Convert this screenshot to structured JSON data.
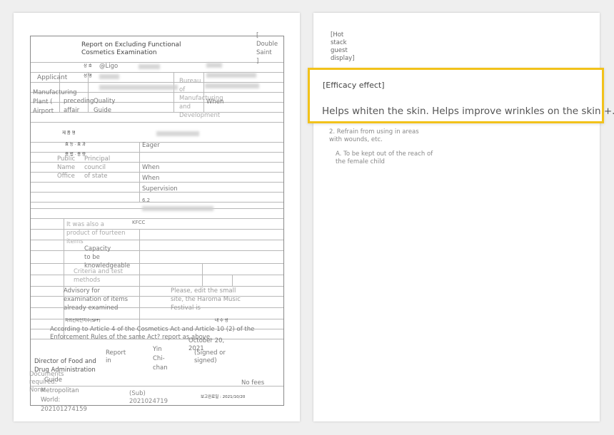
{
  "left_page": {
    "title_line1": "Report on Excluding Functional",
    "title_line2": "Cosmetics Examination",
    "double_saint": [
      "[",
      "Double",
      "Saint",
      "]"
    ],
    "applicant_label": "Applicant",
    "applicant_value": "@Ligo",
    "bureau": [
      "Bureau",
      "of",
      "Manufacturing",
      "and",
      "Development"
    ],
    "when": "When",
    "manufacturing_plant": [
      "Manufacturing",
      "Plant (",
      "Airport"
    ],
    "preceding": [
      "preceding",
      "affair"
    ],
    "quality_guide": [
      "Quality",
      "Guide"
    ],
    "korean_header": [
      "상  호",
      "성  명",
      "제   품   명",
      "효  능 · 효  과",
      "용   법 · 용   량"
    ],
    "eager": "Eager",
    "public_name_office": [
      "Public",
      "Name",
      "Office"
    ],
    "principal_council": [
      "Principal",
      "council",
      "of state"
    ],
    "when2": [
      "When",
      "When"
    ],
    "supervision": "Supervision",
    "version": "6.2",
    "kfcc": "KFCC",
    "fourteen": [
      "It was also a",
      "product of fourteen",
      "items"
    ],
    "capacity": [
      "Capacity",
      "to be",
      "knowledgeable"
    ],
    "criteria": [
      "Criteria and test",
      "methods"
    ],
    "advisory": [
      "Advisory for",
      "examination of items",
      "already examined"
    ],
    "please_edit": [
      "Please, edit the small",
      "site, the Haroma Music",
      "Festival is"
    ],
    "spf_label": "자외선차단지수(SPF)",
    "spf_value": "내 수 성",
    "article_line1": "According to Article 4 of the Cosmetics Act and Article 10 (2) of the",
    "article_line2": "Enforcement Rules of the same Act? report as above.",
    "date": [
      "October 20,",
      "2021"
    ],
    "report_in": [
      "Report",
      "in"
    ],
    "yin": [
      "Yin",
      "Chi-",
      "chan"
    ],
    "signed": [
      "(Signed or",
      "signed)"
    ],
    "director": [
      "Director of Food and",
      "Drug Administration"
    ],
    "documents_required": [
      "Documents",
      "required:",
      "None"
    ],
    "guide": "Guide",
    "no_fees": "No fees",
    "metropolitan": [
      "Metropolitan",
      "World:",
      "202101274159"
    ],
    "sub": [
      "(Sub)",
      "2021024719"
    ],
    "completion": "보고완료일 : 2021/10/20"
  },
  "right_page": {
    "hot_stack": [
      "[Hot",
      "stack",
      "guest",
      "display]"
    ],
    "refrain": [
      "2. Refrain from using in areas",
      "with wounds, etc."
    ],
    "kept_out": [
      "A. To be kept out of the reach of",
      "the female child"
    ]
  },
  "callout": {
    "title": "[Efficacy effect]",
    "body": "Helps whiten the skin. Helps improve wrinkles on the skin +.",
    "border_color": "#f2c21b"
  }
}
